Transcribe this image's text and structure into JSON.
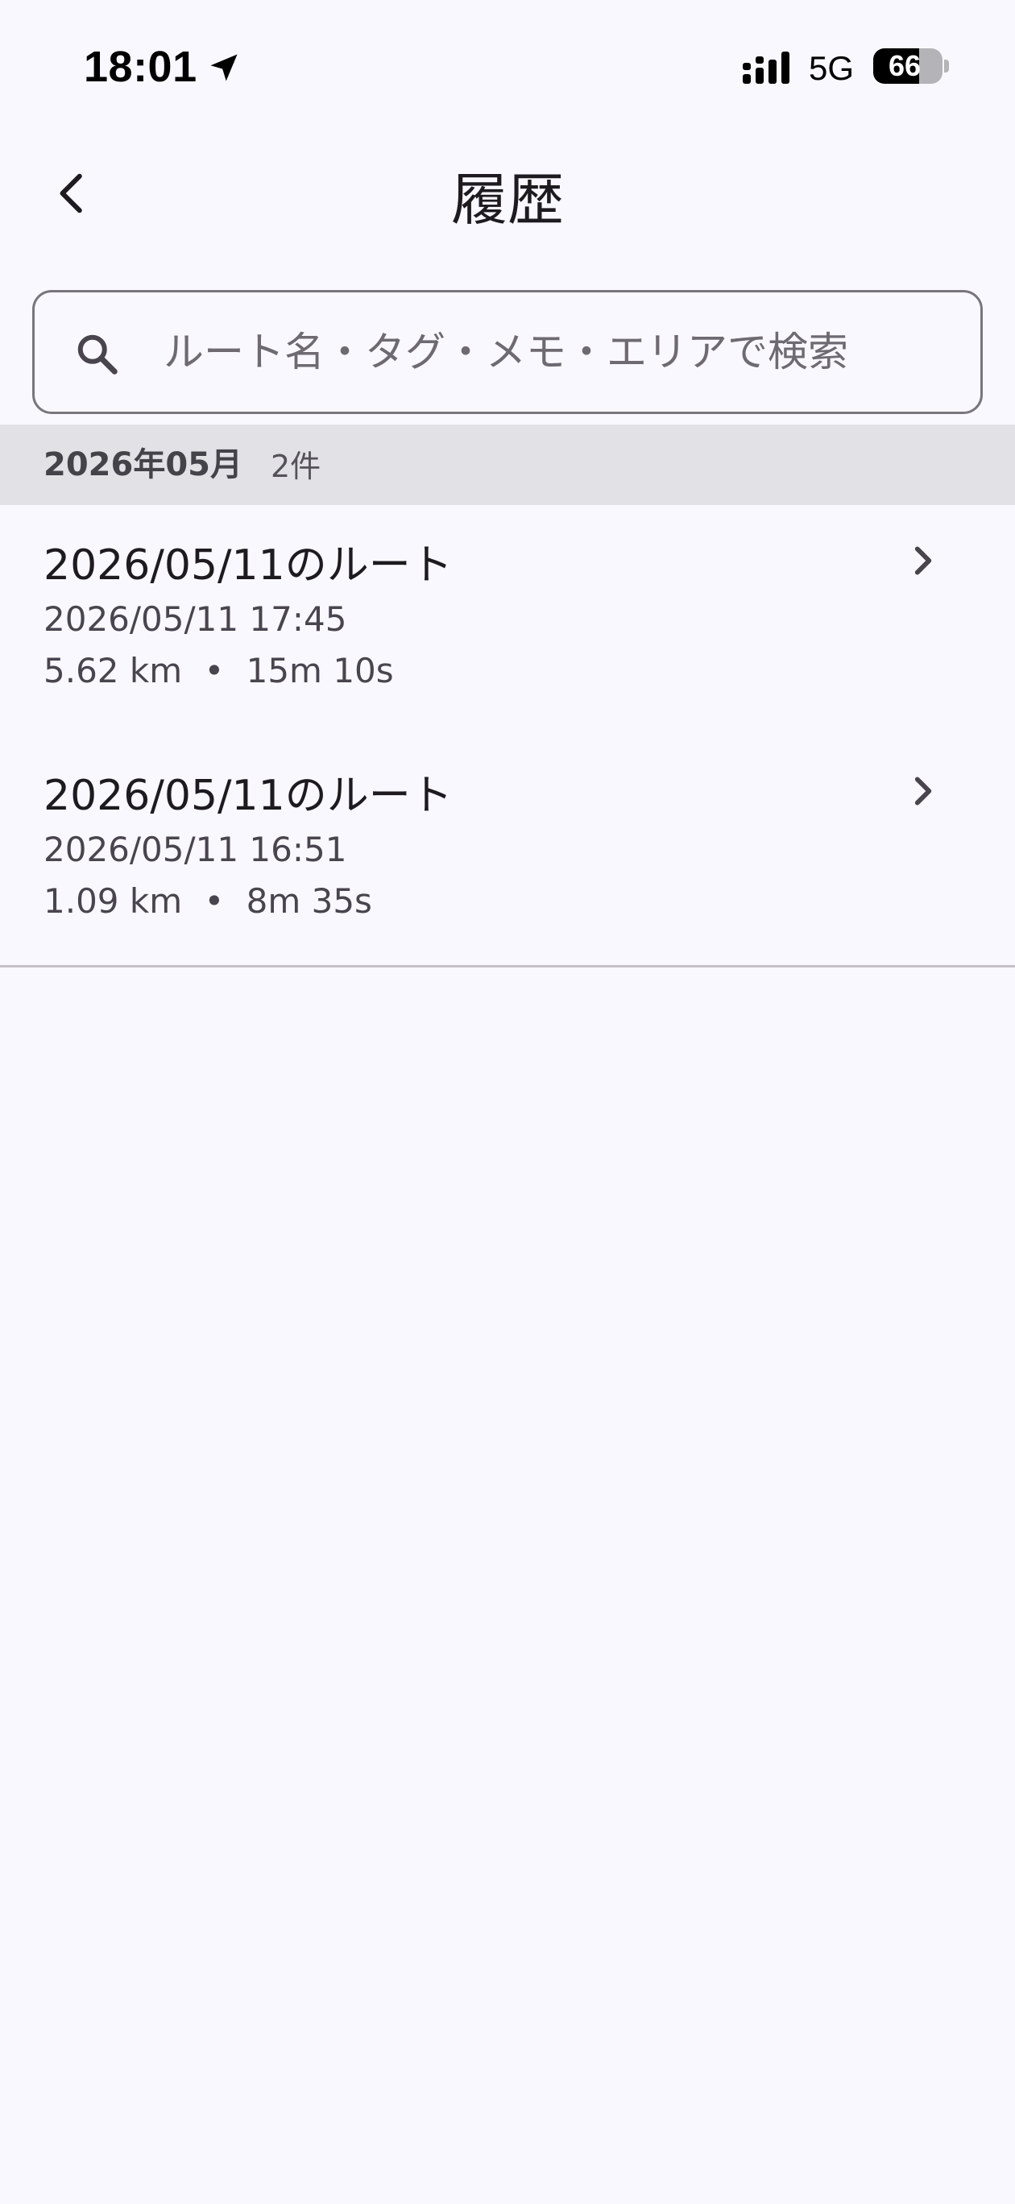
{
  "status_bar": {
    "time": "18:01",
    "network": "5G",
    "battery": "66",
    "battery_level": 0.66
  },
  "header": {
    "title": "履歴"
  },
  "search": {
    "placeholder": "ルート名・タグ・メモ・エリアで検索",
    "value": ""
  },
  "sections": [
    {
      "month_label": "2026年05月",
      "count_label": "2件",
      "routes": [
        {
          "title": "2026/05/11のルート",
          "datetime": "2026/05/11 17:45",
          "distance": "5.62 km",
          "separator": "•",
          "duration": "15m 10s"
        },
        {
          "title": "2026/05/11のルート",
          "datetime": "2026/05/11 16:51",
          "distance": "1.09 km",
          "separator": "•",
          "duration": "8m 35s"
        }
      ]
    }
  ],
  "icons": {
    "back": "arrow-back-icon",
    "search": "search-icon",
    "chevron": "chevron-right-icon",
    "location": "location-arrow-icon",
    "signal": "cellular-signal-icon"
  }
}
